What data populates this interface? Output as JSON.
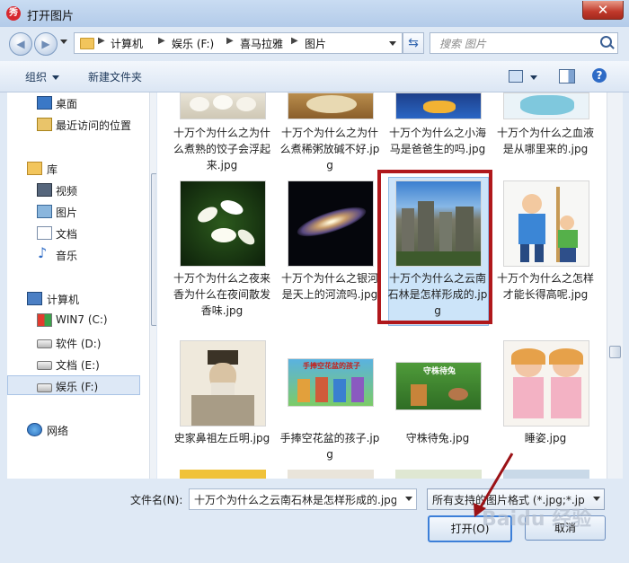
{
  "window": {
    "title": "打开图片",
    "app_icon_glyph": "秀"
  },
  "address": {
    "crumbs": [
      "计算机",
      "娱乐 (F:)",
      "喜马拉雅",
      "图片"
    ],
    "search_placeholder": "搜索 图片"
  },
  "toolbar": {
    "organize": "组织",
    "new_folder": "新建文件夹"
  },
  "sidebar": {
    "items": [
      {
        "label": "桌面",
        "icon": "desktop-icon"
      },
      {
        "label": "最近访问的位置",
        "icon": "recent-places-icon"
      },
      {
        "label": "库",
        "icon": "library-icon"
      },
      {
        "label": "视频",
        "icon": "video-library-icon"
      },
      {
        "label": "图片",
        "icon": "pictures-library-icon"
      },
      {
        "label": "文档",
        "icon": "documents-library-icon"
      },
      {
        "label": "音乐",
        "icon": "music-library-icon"
      },
      {
        "label": "计算机",
        "icon": "computer-icon"
      },
      {
        "label": "WIN7 (C:)",
        "icon": "system-drive-icon"
      },
      {
        "label": "软件 (D:)",
        "icon": "drive-icon"
      },
      {
        "label": "文档 (E:)",
        "icon": "drive-icon"
      },
      {
        "label": "娱乐 (F:)",
        "icon": "drive-icon",
        "selected": true
      },
      {
        "label": "网络",
        "icon": "network-icon"
      }
    ]
  },
  "files": {
    "row1": [
      {
        "caption": "十万个为什么之为什么煮熟的饺子会浮起来.jpg"
      },
      {
        "caption": "十万个为什么之为什么煮稀粥放碱不好.jpg"
      },
      {
        "caption": "十万个为什么之小海马是爸爸生的吗.jpg"
      },
      {
        "caption": "十万个为什么之血液是从哪里来的.jpg"
      }
    ],
    "row2": [
      {
        "caption": "十万个为什么之夜来香为什么在夜间散发香味.jpg"
      },
      {
        "caption": "十万个为什么之银河是天上的河流吗.jpg"
      },
      {
        "caption": "十万个为什么之云南石林是怎样形成的.jpg",
        "selected": true
      },
      {
        "caption": "十万个为什么之怎样才能长得高呢.jpg"
      }
    ],
    "row3": [
      {
        "caption": "史家鼻祖左丘明.jpg"
      },
      {
        "caption": "手捧空花盆的孩子.jpg",
        "thumb_text": "手捧空花盆的孩子"
      },
      {
        "caption": "守株待兔.jpg",
        "thumb_text": "守株待兔"
      },
      {
        "caption": "睡姿.jpg"
      }
    ]
  },
  "footer": {
    "filename_label": "文件名(N):",
    "filename_value": "十万个为什么之云南石林是怎样形成的.jpg",
    "filetype_value": "所有支持的图片格式 (*.jpg;*.jp",
    "open_button": "打开(O)",
    "cancel_button": "取消"
  },
  "watermark": "Baidu 经验",
  "colors": {
    "highlight": "#b0181c",
    "selection": "#cce4f9",
    "chrome": "#dfe9f5"
  }
}
